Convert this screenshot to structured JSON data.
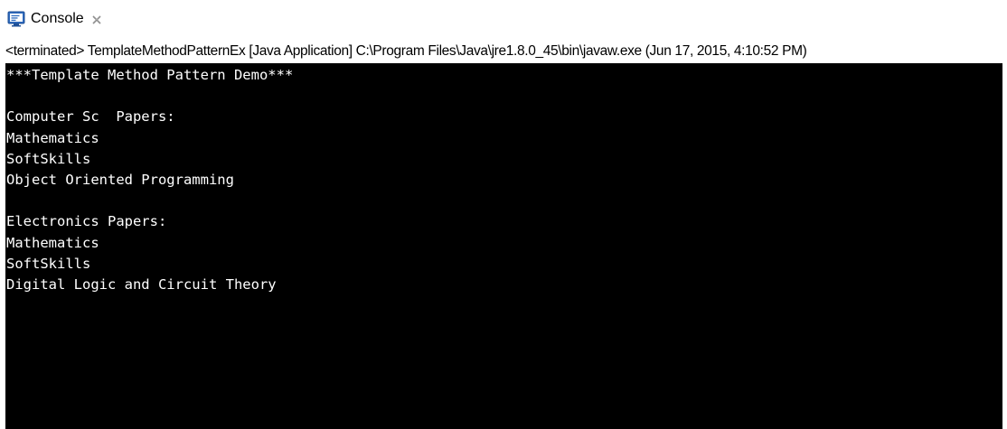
{
  "tab": {
    "title": "Console",
    "icon": "console-icon",
    "close_icon": "close-icon"
  },
  "status": {
    "text": "<terminated> TemplateMethodPatternEx [Java Application] C:\\Program Files\\Java\\jre1.8.0_45\\bin\\javaw.exe (Jun 17, 2015, 4:10:52 PM)"
  },
  "console": {
    "background": "#000000",
    "foreground": "#ffffff",
    "lines": [
      "***Template Method Pattern Demo***",
      "",
      "Computer Sc  Papers:",
      "Mathematics",
      "SoftSkills",
      "Object Oriented Programming",
      "",
      "Electronics Papers:",
      "Mathematics",
      "SoftSkills",
      "Digital Logic and Circuit Theory"
    ]
  }
}
